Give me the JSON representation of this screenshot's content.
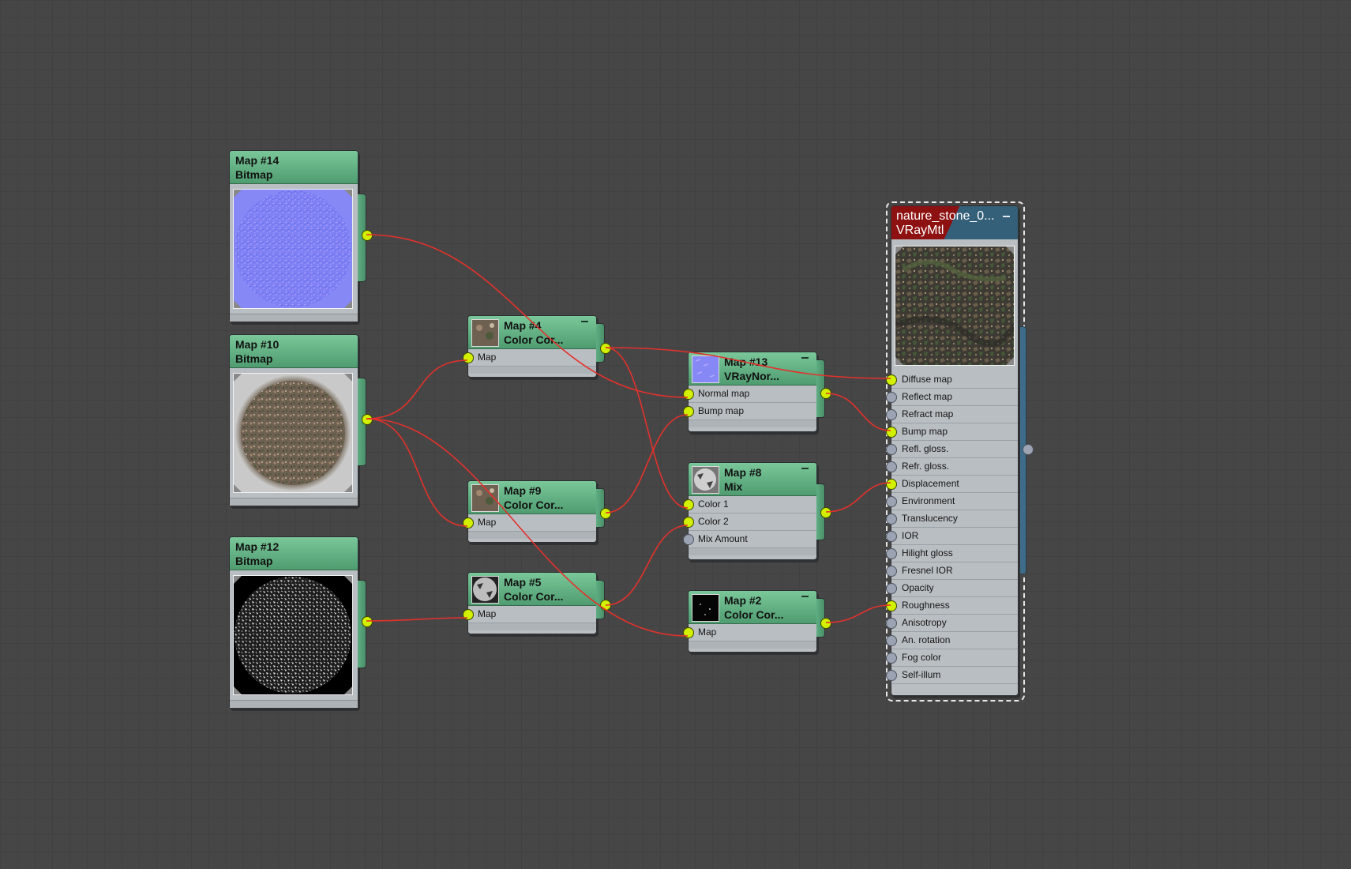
{
  "editor": {
    "name": "Slate Material Editor",
    "wire_color": "#e4312b",
    "socket_color": "#d2f000",
    "socket_inactive_color": "#9ca4b3",
    "node_header_color": "#5aa97c",
    "material_header_colors": [
      "#8e1111",
      "#35607a"
    ]
  },
  "nodes": {
    "map14": {
      "name": "Map #14",
      "type": "Bitmap",
      "preview_icon": "normal-map-preview"
    },
    "map10": {
      "name": "Map #10",
      "type": "Bitmap",
      "preview_icon": "stone-diffuse-preview"
    },
    "map12": {
      "name": "Map #12",
      "type": "Bitmap",
      "preview_icon": "bw-roughness-preview"
    },
    "map4": {
      "name": "Map #4",
      "type": "Color Cor...",
      "inputs": [
        "Map"
      ]
    },
    "map9": {
      "name": "Map #9",
      "type": "Color Cor...",
      "inputs": [
        "Map"
      ]
    },
    "map5": {
      "name": "Map #5",
      "type": "Color Cor...",
      "inputs": [
        "Map"
      ]
    },
    "map13": {
      "name": "Map #13",
      "type": "VRayNor...",
      "inputs": [
        "Normal map",
        "Bump map"
      ]
    },
    "map8": {
      "name": "Map #8",
      "type": "Mix",
      "inputs": [
        "Color 1",
        "Color 2",
        "Mix Amount"
      ]
    },
    "map2": {
      "name": "Map #2",
      "type": "Color Cor...",
      "inputs": [
        "Map"
      ]
    }
  },
  "material": {
    "name": "nature_stone_0...",
    "type": "VRayMtl",
    "slots": [
      {
        "label": "Diffuse map",
        "connected": true
      },
      {
        "label": "Reflect map",
        "connected": false
      },
      {
        "label": "Refract map",
        "connected": false
      },
      {
        "label": "Bump map",
        "connected": true
      },
      {
        "label": "Refl. gloss.",
        "connected": false
      },
      {
        "label": "Refr. gloss.",
        "connected": false
      },
      {
        "label": "Displacement",
        "connected": true
      },
      {
        "label": "Environment",
        "connected": false
      },
      {
        "label": "Translucency",
        "connected": false
      },
      {
        "label": "IOR",
        "connected": false
      },
      {
        "label": "Hilight gloss",
        "connected": false
      },
      {
        "label": "Fresnel IOR",
        "connected": false
      },
      {
        "label": "Opacity",
        "connected": false
      },
      {
        "label": "Roughness",
        "connected": true
      },
      {
        "label": "Anisotropy",
        "connected": false
      },
      {
        "label": "An. rotation",
        "connected": false
      },
      {
        "label": "Fog color",
        "connected": false
      },
      {
        "label": "Self-illum",
        "connected": false
      }
    ]
  },
  "connections": [
    {
      "from": "Map #14",
      "to": "Map #13",
      "slot": "Normal map"
    },
    {
      "from": "Map #10",
      "to": "Map #4",
      "slot": "Map"
    },
    {
      "from": "Map #10",
      "to": "Map #9",
      "slot": "Map"
    },
    {
      "from": "Map #10",
      "to": "Map #2",
      "slot": "Map"
    },
    {
      "from": "Map #12",
      "to": "Map #5",
      "slot": "Map"
    },
    {
      "from": "Map #4",
      "to": "nature_stone_0...",
      "slot": "Diffuse map"
    },
    {
      "from": "Map #4",
      "to": "Map #8",
      "slot": "Color 1"
    },
    {
      "from": "Map #9",
      "to": "Map #13",
      "slot": "Bump map"
    },
    {
      "from": "Map #5",
      "to": "Map #8",
      "slot": "Color 2"
    },
    {
      "from": "Map #13",
      "to": "nature_stone_0...",
      "slot": "Bump map"
    },
    {
      "from": "Map #8",
      "to": "nature_stone_0...",
      "slot": "Displacement"
    },
    {
      "from": "Map #2",
      "to": "nature_stone_0...",
      "slot": "Roughness"
    }
  ]
}
